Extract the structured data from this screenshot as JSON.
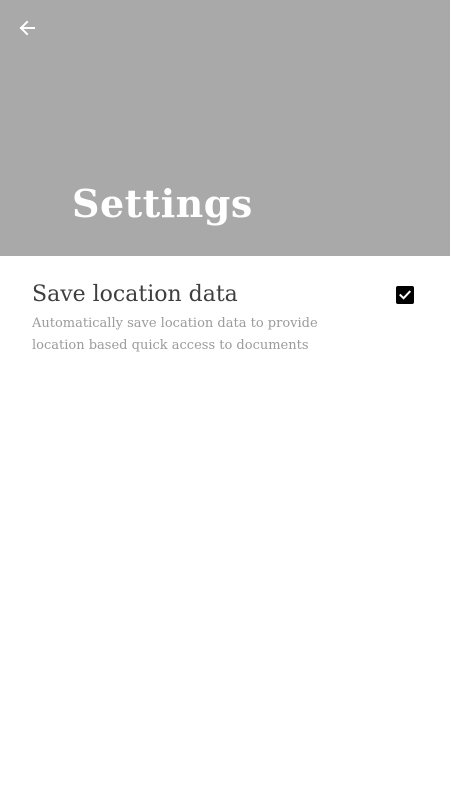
{
  "header": {
    "title": "Settings",
    "back_icon": "arrow-left-icon",
    "background_color": "#a9a9a9"
  },
  "settings": {
    "items": [
      {
        "title": "Save location data",
        "description": "Automatically save location data to provide location based quick access to documents",
        "checked": true,
        "checkbox_icon": "checkmark-icon"
      }
    ]
  },
  "colors": {
    "title_text": "#ffffff",
    "item_title": "#3f3f3f",
    "item_description": "#9b9b9b",
    "checkbox": "#000000"
  }
}
